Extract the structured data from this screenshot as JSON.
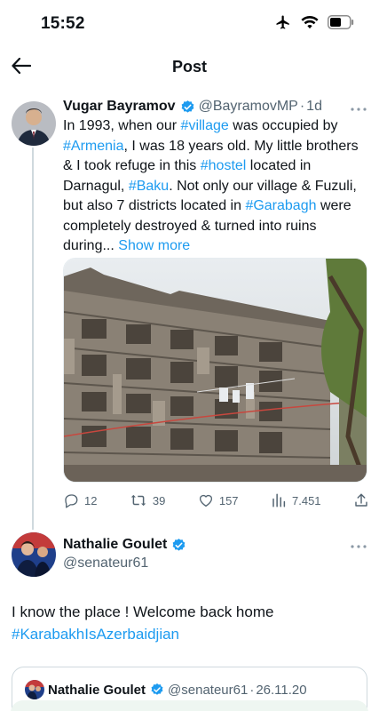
{
  "status_bar": {
    "time": "15:52",
    "icons": [
      "airplane-icon",
      "wifi-icon",
      "battery-icon"
    ]
  },
  "header": {
    "title": "Post",
    "back_icon": "arrow-left-icon"
  },
  "main_tweet": {
    "author_name": "Vugar Bayramov",
    "handle": "@BayramovMP",
    "separator": "·",
    "time": "1d",
    "text_parts": {
      "p1": "In 1993, when our ",
      "h1": "#village",
      "p2": " was occupied by ",
      "h2": "#Armenia",
      "p3": ", I was 18 years old. My little brothers & I took refuge in this ",
      "h3": "#hostel",
      "p4": " located in Darnagul, ",
      "h4": "#Baku",
      "p5": ". Not only our village & Fuzuli, but also 7 districts located in ",
      "h5": "#Garabagh",
      "p6": " were completely destroyed & turned into ruins during... "
    },
    "show_more": "Show more",
    "stats": {
      "replies": "12",
      "reposts": "39",
      "likes": "157",
      "views": "7.451"
    }
  },
  "reply": {
    "author_name": "Nathalie Goulet",
    "handle": "@senateur61",
    "text": "I know the place ! Welcome back home",
    "hashtag": "#KarabakhIsAzerbaidjian"
  },
  "quoted": {
    "author_name": "Nathalie Goulet",
    "handle": "@senateur61",
    "separator": "·",
    "date": "26.11.20"
  },
  "colors": {
    "accent": "#1d9bf0",
    "secondary_text": "#536471",
    "verified": "#1d9bf0"
  }
}
